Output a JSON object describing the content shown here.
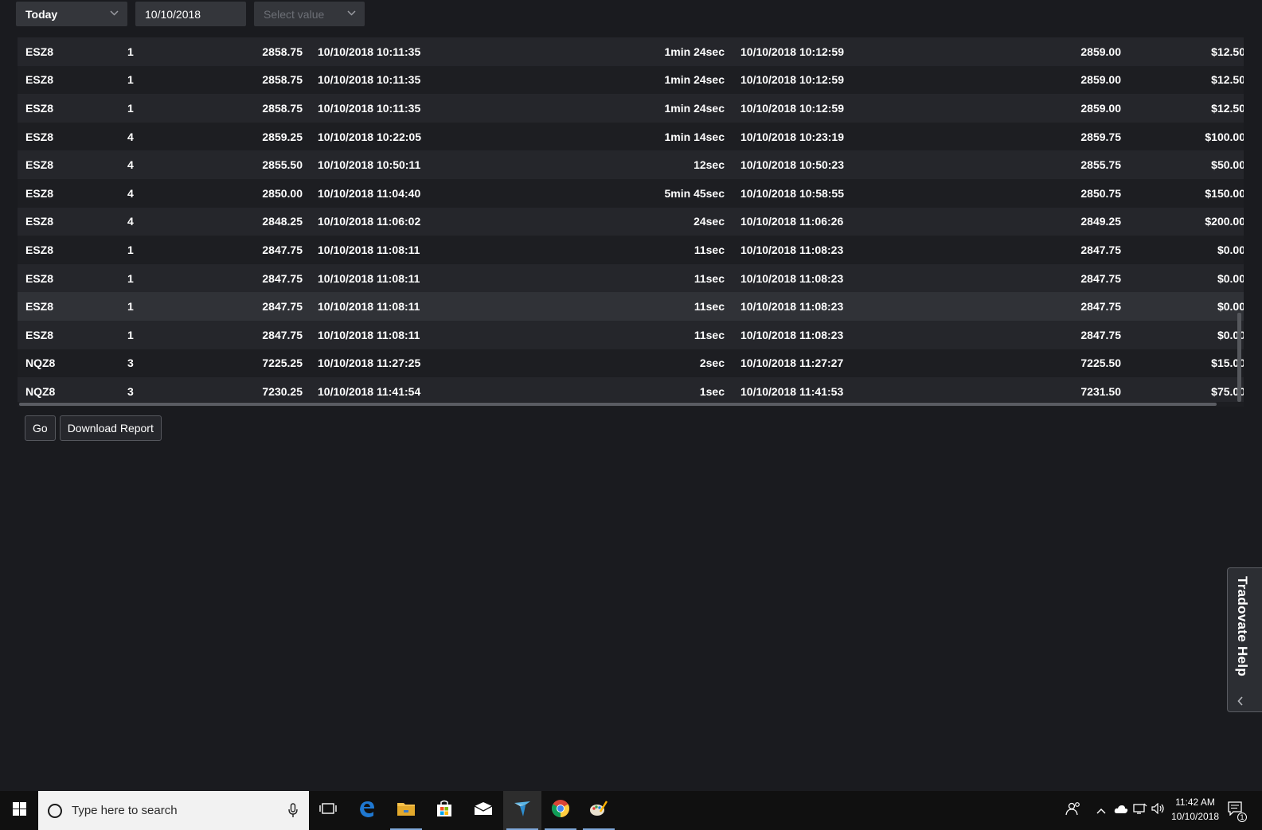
{
  "filters": {
    "period": "Today",
    "date": "10/10/2018",
    "value_placeholder": "Select value"
  },
  "rows": [
    [
      "ESZ8",
      "1",
      "2858.75",
      "10/10/2018 10:11:35",
      "1min 24sec",
      "10/10/2018 10:12:59",
      "2859.00",
      "$12.50"
    ],
    [
      "ESZ8",
      "1",
      "2858.75",
      "10/10/2018 10:11:35",
      "1min 24sec",
      "10/10/2018 10:12:59",
      "2859.00",
      "$12.50"
    ],
    [
      "ESZ8",
      "1",
      "2858.75",
      "10/10/2018 10:11:35",
      "1min 24sec",
      "10/10/2018 10:12:59",
      "2859.00",
      "$12.50"
    ],
    [
      "ESZ8",
      "4",
      "2859.25",
      "10/10/2018 10:22:05",
      "1min 14sec",
      "10/10/2018 10:23:19",
      "2859.75",
      "$100.00"
    ],
    [
      "ESZ8",
      "4",
      "2855.50",
      "10/10/2018 10:50:11",
      "12sec",
      "10/10/2018 10:50:23",
      "2855.75",
      "$50.00"
    ],
    [
      "ESZ8",
      "4",
      "2850.00",
      "10/10/2018 11:04:40",
      "5min 45sec",
      "10/10/2018 10:58:55",
      "2850.75",
      "$150.00"
    ],
    [
      "ESZ8",
      "4",
      "2848.25",
      "10/10/2018 11:06:02",
      "24sec",
      "10/10/2018 11:06:26",
      "2849.25",
      "$200.00"
    ],
    [
      "ESZ8",
      "1",
      "2847.75",
      "10/10/2018 11:08:11",
      "11sec",
      "10/10/2018 11:08:23",
      "2847.75",
      "$0.00"
    ],
    [
      "ESZ8",
      "1",
      "2847.75",
      "10/10/2018 11:08:11",
      "11sec",
      "10/10/2018 11:08:23",
      "2847.75",
      "$0.00"
    ],
    [
      "ESZ8",
      "1",
      "2847.75",
      "10/10/2018 11:08:11",
      "11sec",
      "10/10/2018 11:08:23",
      "2847.75",
      "$0.00"
    ],
    [
      "ESZ8",
      "1",
      "2847.75",
      "10/10/2018 11:08:11",
      "11sec",
      "10/10/2018 11:08:23",
      "2847.75",
      "$0.00"
    ],
    [
      "NQZ8",
      "3",
      "7225.25",
      "10/10/2018 11:27:25",
      "2sec",
      "10/10/2018 11:27:27",
      "7225.50",
      "$15.00"
    ],
    [
      "NQZ8",
      "3",
      "7230.25",
      "10/10/2018 11:41:54",
      "1sec",
      "10/10/2018 11:41:53",
      "7231.50",
      "$75.00"
    ]
  ],
  "hover_row_index": 9,
  "actions": {
    "go_label": "Go",
    "download_label": "Download Report"
  },
  "help_tab": {
    "label": "Tradovate Help"
  },
  "taskbar": {
    "search_placeholder": "Type here to search",
    "apps": [
      "task-view-icon",
      "edge-icon",
      "file-explorer-icon",
      "store-icon",
      "mail-icon",
      "tradovate-icon",
      "chrome-icon",
      "paint-icon"
    ],
    "active_app": "tradovate-icon",
    "time": "11:42 AM",
    "date": "10/10/2018",
    "notification_count": "1"
  },
  "colors": {
    "background": "#1a1b1f",
    "row_odd": "#25262b",
    "row_even": "#1d1e22",
    "control": "#34363b",
    "text": "#ffffff"
  }
}
